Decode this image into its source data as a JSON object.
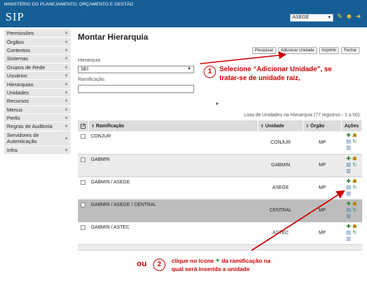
{
  "header": {
    "ministry": "MINISTÉRIO DO PLANEJAMENTO, ORÇAMENTO E GESTÃO",
    "logo": "SIP",
    "unit_selected": "ASEGE"
  },
  "sidebar": {
    "items": [
      {
        "label": "Permissões"
      },
      {
        "label": "Órgãos"
      },
      {
        "label": "Contextos"
      },
      {
        "label": "Sistemas"
      },
      {
        "label": "Grupos de Rede"
      },
      {
        "label": "Usuários"
      },
      {
        "label": "Hierarquias"
      },
      {
        "label": "Unidades"
      },
      {
        "label": "Recursos"
      },
      {
        "label": "Menus"
      },
      {
        "label": "Perfis"
      },
      {
        "label": "Regras de Auditoria"
      },
      {
        "label": "Servidores de Autenticação"
      },
      {
        "label": "Infra"
      }
    ]
  },
  "main": {
    "title": "Montar Hierarquia",
    "buttons": {
      "pesquisar": "Pesquisar",
      "adicionar": "Adicionar Unidade",
      "imprimir": "Imprimir",
      "fechar": "Fechar"
    },
    "hierarquia_label": "Hierarquia:",
    "hierarquia_value": "SEI",
    "ramificacao_label": "Ramificação:",
    "ramificacao_value": "",
    "table_caption": "Lista de Unidades na Hierarquia (77 registros - 1 a 50):",
    "columns": {
      "ramificacao": "Ramificação",
      "unidade": "Unidade",
      "orgao": "Órgão",
      "acoes": "Ações"
    },
    "rows": [
      {
        "ramificacao": "CONJUR",
        "unidade": "CONJUR",
        "orgao": "MP"
      },
      {
        "ramificacao": "GABMIN",
        "unidade": "GABMIN",
        "orgao": "MP"
      },
      {
        "ramificacao": "GABMIN / ASEGE",
        "unidade": "ASEGE",
        "orgao": "MP"
      },
      {
        "ramificacao": "GABMIN / ASEGE / CENTRAL",
        "unidade": "CENTRAL",
        "orgao": "MP"
      },
      {
        "ramificacao": "GABMIN / ASTEC",
        "unidade": "ASTEC",
        "orgao": "MP"
      }
    ]
  },
  "annotations": {
    "step1_number": "1",
    "step1_line1": "Selecione “Adicionar Unidade”, se",
    "step1_line2": "tratar-se de unidade raiz,",
    "ou": "ou",
    "step2_number": "2",
    "step2_prefix": "clique no ícone",
    "step2_plus": "+",
    "step2_suffix": "da ramificação na",
    "step2_line2": "qual será inserida a unidade",
    "color": "#cc0000"
  }
}
